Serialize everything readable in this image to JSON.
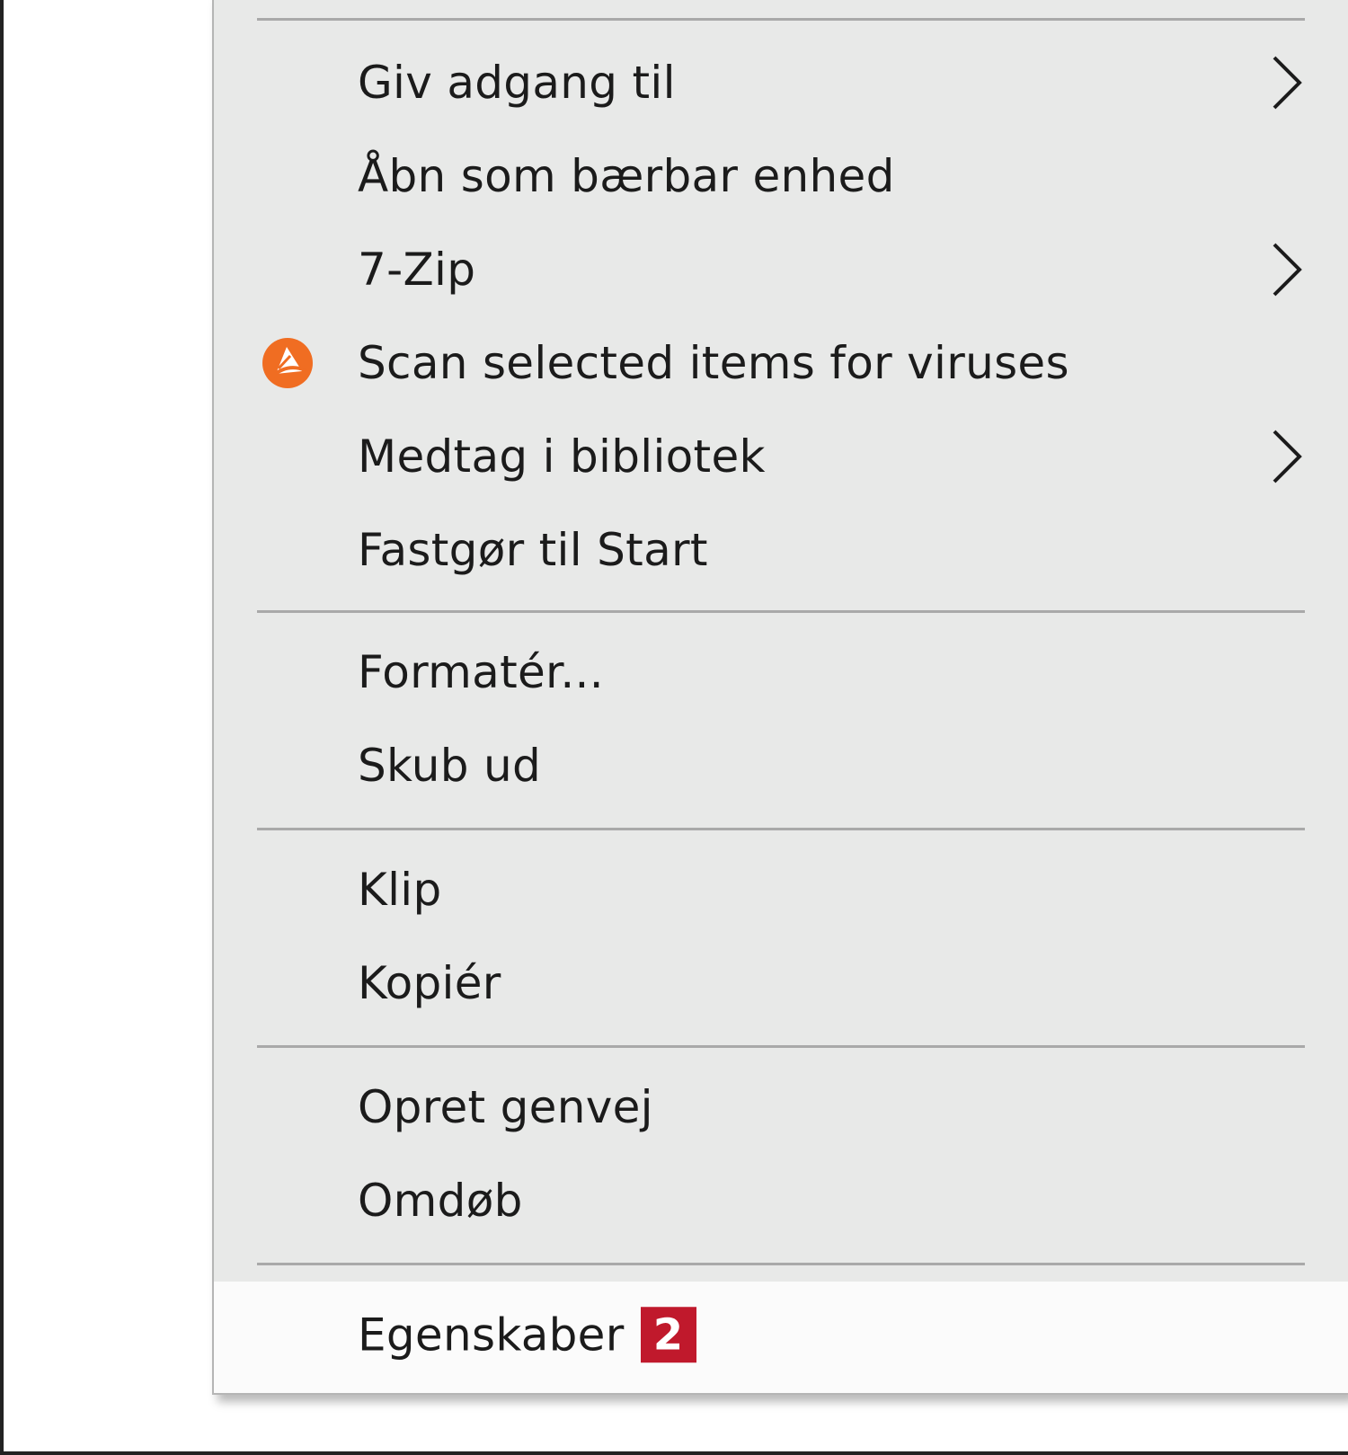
{
  "menu": {
    "items": [
      {
        "label": "Giv adgang til"
      },
      {
        "label": "Åbn som bærbar enhed"
      },
      {
        "label": "7-Zip"
      },
      {
        "label": "Scan selected items for viruses",
        "icon": "avast-antivirus-icon"
      },
      {
        "label": "Medtag i bibliotek"
      },
      {
        "label": "Fastgør til Start"
      },
      {
        "label": "Formatér..."
      },
      {
        "label": "Skub ud"
      },
      {
        "label": "Klip"
      },
      {
        "label": "Kopiér"
      },
      {
        "label": "Opret genvej"
      },
      {
        "label": "Omdøb"
      },
      {
        "label": "Egenskaber",
        "badge": "2"
      }
    ]
  },
  "colors": {
    "menu_background": "#e8e9e8",
    "highlight_background": "#fbfbfb",
    "badge_red": "#c0192c",
    "avast_orange": "#f06d22"
  }
}
